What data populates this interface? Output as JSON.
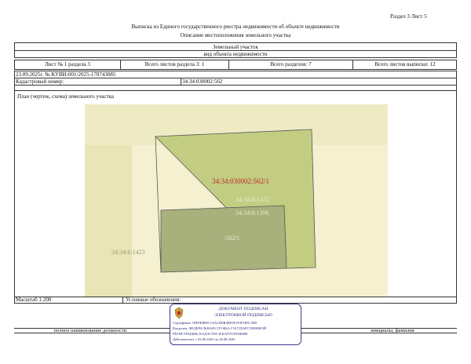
{
  "header": {
    "section_page": "Раздел 3   Лист 5",
    "title": "Выписка из Единого государственного реестра недвижимости об объекте недвижимости",
    "subtitle": "Описание местоположения земельного участка"
  },
  "object": {
    "type": "Земельный участок",
    "type_caption": "вид объекта недвижимости"
  },
  "sheet_row": {
    "sheet": "Лист № 1 раздела 3",
    "sheets_in_section": "Всего листов раздела 3: 1",
    "total_sections": "Всего разделов: 7",
    "total_sheets": "Всего листов выписки: 12"
  },
  "record": {
    "date_number": "23.09.2025г. № КУВИ-001/2025-178743085",
    "cadastral_label": "Кадастровый номер:",
    "cadastral_number": "34:34:030002:562"
  },
  "plan": {
    "title": "План (чертеж, схема) земельного участка",
    "labels": {
      "main_parcel": "34:34:030002:562/1",
      "overlap_a": "34:34:6:1472",
      "overlap_b": "34:34:6:1396",
      "inner_part": ":562/1",
      "neighbor": "34:34:6:1423"
    },
    "colors": {
      "background": "#f4f0d0",
      "area": "#e9e5b6",
      "parcel": "#c2cd82",
      "part": "#a8b07c",
      "label": "#c0282c"
    }
  },
  "footer": {
    "scale": "Масштаб 1:200",
    "legend": "Условные обозначения:",
    "position_caption": "полное наименование должности",
    "name_caption": "инициалы, фамилия"
  },
  "stamp": {
    "line1": "ДОКУМЕНТ ПОДПИСАН",
    "line2": "ЭЛЕКТРОННОЙ ПОДПИСЬЮ",
    "cert": "Сертификат: 00FFB8B5C54ACD8B4BF6F1F2F5F6C5B0",
    "owner1": "Владелец: ФЕДЕРАЛЬНАЯ СЛУЖБА ГОСУДАРСТВЕННОЙ",
    "owner2": "РЕГИСТРАЦИИ, КАДАСТРА И КАРТОГРАФИИ",
    "valid": "Действителен: с 02.06.2025 по 26.08.2026"
  }
}
